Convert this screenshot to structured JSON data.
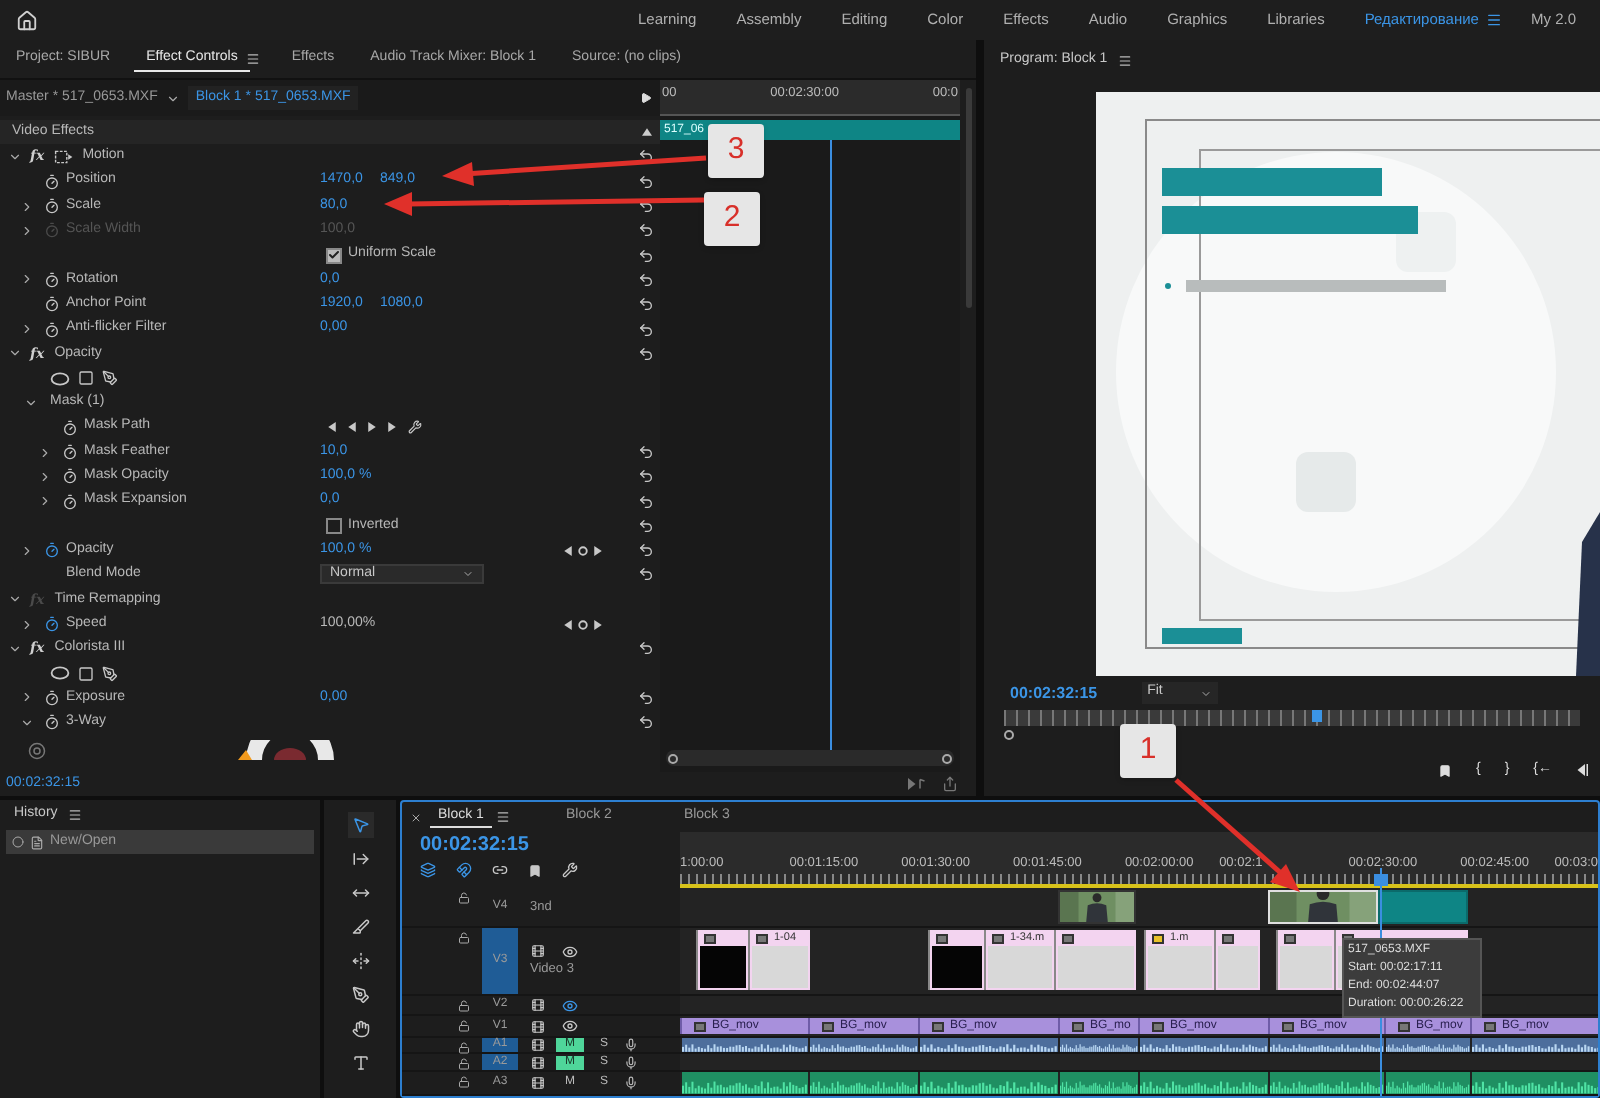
{
  "workspace": {
    "tabs": [
      {
        "label": "Learning",
        "selected": false
      },
      {
        "label": "Assembly",
        "selected": false
      },
      {
        "label": "Editing",
        "selected": false
      },
      {
        "label": "Color",
        "selected": false
      },
      {
        "label": "Effects",
        "selected": false
      },
      {
        "label": "Audio",
        "selected": false
      },
      {
        "label": "Graphics",
        "selected": false
      },
      {
        "label": "Libraries",
        "selected": false
      },
      {
        "label": "Редактирование",
        "selected": true
      },
      {
        "label": "My 2.0",
        "selected": false
      }
    ]
  },
  "panels": {
    "tabs": [
      {
        "label": "Project: SIBUR",
        "selected": false
      },
      {
        "label": "Effect Controls",
        "selected": true
      },
      {
        "label": "Effects",
        "selected": false
      },
      {
        "label": "Audio Track Mixer: Block 1",
        "selected": false
      },
      {
        "label": "Source: (no clips)",
        "selected": false
      }
    ]
  },
  "effect_controls": {
    "master_clip": "Master * 517_0653.MXF",
    "sequence_clip": "Block 1 * 517_0653.MXF",
    "ruler": [
      "00",
      "00:02:30:00",
      "00:0"
    ],
    "clip": "517_06",
    "header": "Video Effects",
    "effects": [
      {
        "kind": "effect",
        "badge": "fx",
        "label": "Motion",
        "fx_enabled": true,
        "motion_icon": true,
        "expanded": true,
        "reset": true,
        "children": [
          {
            "kind": "property",
            "label": "Position",
            "values": [
              "1470,0",
              "849,0"
            ],
            "expandable": false,
            "animated": false,
            "disabled": false,
            "keyframe_nav": false,
            "reset": true
          },
          {
            "kind": "property",
            "label": "Scale",
            "values": [
              "80,0"
            ],
            "expandable": true,
            "expanded": false,
            "animated": false,
            "disabled": false,
            "keyframe_nav": false,
            "reset": true
          },
          {
            "kind": "property",
            "label": "Scale Width",
            "values": [
              "100,0"
            ],
            "expandable": true,
            "expanded": false,
            "animated": false,
            "disabled": true,
            "keyframe_nav": false,
            "reset": true
          },
          {
            "kind": "checkbox",
            "label": "Uniform Scale",
            "checked": true,
            "reset": true
          },
          {
            "kind": "property",
            "label": "Rotation",
            "values": [
              "0,0"
            ],
            "expandable": true,
            "expanded": false,
            "animated": false,
            "disabled": false,
            "keyframe_nav": false,
            "reset": true
          },
          {
            "kind": "property",
            "label": "Anchor Point",
            "values": [
              "1920,0",
              "1080,0"
            ],
            "expandable": false,
            "animated": false,
            "disabled": false,
            "keyframe_nav": false,
            "reset": true
          },
          {
            "kind": "property",
            "label": "Anti-flicker Filter",
            "values": [
              "0,00"
            ],
            "expandable": true,
            "expanded": false,
            "animated": false,
            "disabled": false,
            "keyframe_nav": false,
            "reset": true
          }
        ]
      },
      {
        "kind": "effect",
        "badge": "fx",
        "label": "Opacity",
        "fx_enabled": true,
        "motion_icon": false,
        "expanded": true,
        "reset": true,
        "children": [
          {
            "kind": "mask_tools"
          },
          {
            "kind": "group",
            "label": "Mask (1)",
            "expanded": true,
            "children": [
              {
                "kind": "mask_path",
                "label": "Mask Path"
              },
              {
                "kind": "property",
                "label": "Mask Feather",
                "values": [
                  "10,0"
                ],
                "expandable": true,
                "expanded": false,
                "animated": false,
                "disabled": false,
                "keyframe_nav": false,
                "reset": true
              },
              {
                "kind": "property",
                "label": "Mask Opacity",
                "values": [
                  "100,0 %"
                ],
                "expandable": true,
                "expanded": false,
                "animated": false,
                "disabled": false,
                "keyframe_nav": false,
                "reset": true
              },
              {
                "kind": "property",
                "label": "Mask Expansion",
                "values": [
                  "0,0"
                ],
                "expandable": true,
                "expanded": false,
                "animated": false,
                "disabled": false,
                "keyframe_nav": false,
                "reset": true
              },
              {
                "kind": "checkbox",
                "label": "Inverted",
                "checked": false,
                "reset": true
              }
            ]
          },
          {
            "kind": "property",
            "label": "Opacity",
            "values": [
              "100,0 %"
            ],
            "expandable": true,
            "expanded": false,
            "animated": true,
            "disabled": false,
            "keyframe_nav": true,
            "reset": true
          },
          {
            "kind": "dropdown",
            "label": "Blend Mode",
            "value": "Normal",
            "reset": true
          }
        ]
      },
      {
        "kind": "effect",
        "badge": "fx",
        "label": "Time Remapping",
        "fx_enabled": false,
        "motion_icon": false,
        "expanded": true,
        "reset": false,
        "children": [
          {
            "kind": "property",
            "label": "Speed",
            "values": [
              "100,00%"
            ],
            "expandable": true,
            "expanded": false,
            "animated": true,
            "disabled": false,
            "keyframe_nav": true,
            "reset": false
          }
        ]
      },
      {
        "kind": "effect",
        "badge": "fx",
        "label": "Colorista III",
        "fx_enabled": true,
        "motion_icon": false,
        "expanded": true,
        "reset": true,
        "children": [
          {
            "kind": "mask_tools"
          },
          {
            "kind": "property",
            "label": "Exposure",
            "values": [
              "0,00"
            ],
            "expandable": true,
            "expanded": false,
            "animated": false,
            "disabled": false,
            "keyframe_nav": false,
            "reset": true
          },
          {
            "kind": "property",
            "label": "3-Way",
            "expandable": true,
            "expanded": true,
            "animated": false,
            "disabled": false,
            "keyframe_nav": false,
            "reset": true,
            "children": [
              {
                "kind": "color_wheel"
              }
            ]
          }
        ]
      }
    ],
    "timecode": "00:02:32:15"
  },
  "program": {
    "title": "Program: Block 1",
    "timecode": "00:02:32:15",
    "zoom": "Fit",
    "buttons": [
      {
        "kind": "marker"
      },
      {
        "kind": "glyph",
        "label": "{"
      },
      {
        "kind": "glyph",
        "label": "}"
      },
      {
        "kind": "glyph",
        "label": "{←"
      },
      {
        "kind": "step_back"
      }
    ]
  },
  "history": {
    "title": "History",
    "items": [
      {
        "label": "New/Open",
        "selected": true
      }
    ]
  },
  "tools": [
    {
      "kind": "selection",
      "selected": true
    },
    {
      "kind": "track_select",
      "selected": false
    },
    {
      "kind": "ripple",
      "selected": false
    },
    {
      "kind": "razor",
      "selected": false
    },
    {
      "kind": "slip",
      "selected": false
    },
    {
      "kind": "pen",
      "selected": false
    },
    {
      "kind": "hand",
      "selected": false
    },
    {
      "kind": "type",
      "selected": false
    }
  ],
  "timeline": {
    "tabs": [
      {
        "label": "Block 1",
        "selected": true
      },
      {
        "label": "Block 2",
        "selected": false
      },
      {
        "label": "Block 3",
        "selected": false
      }
    ],
    "timecode": "00:02:32:15",
    "snap": true,
    "ruler": [
      "1:00:00",
      "00:01:15:00",
      "00:01:30:00",
      "00:01:45:00",
      "00:02:00:00",
      "00:02:1",
      "00:02:30:00",
      "00:02:45:00",
      "00:03:0"
    ],
    "tracks": [
      {
        "label": "V4",
        "kind": "video",
        "name": "3nd",
        "targeted": false,
        "controls": false,
        "clips": [
          {
            "kind": "footage",
            "selected": false
          },
          {
            "kind": "footage",
            "selected": true
          },
          {
            "kind": "solid",
            "selected": false
          }
        ]
      },
      {
        "label": "V3",
        "kind": "video",
        "name": "Video 3",
        "targeted": true,
        "controls": true,
        "eye_highlighted": false,
        "clips": [
          {
            "kind": "dark",
            "fx_applied": false
          },
          {
            "kind": "light",
            "label": "1-04",
            "fx_applied": false
          },
          {
            "kind": "dark",
            "fx_applied": false
          },
          {
            "kind": "light",
            "label": "1-34.m",
            "fx_applied": false
          },
          {
            "kind": "light",
            "fx_applied": false
          },
          {
            "kind": "light",
            "label": "1.m",
            "fx_applied": true
          },
          {
            "kind": "light",
            "fx_applied": false
          },
          {
            "kind": "light",
            "fx_applied": false
          },
          {
            "kind": "light",
            "fx_applied": false
          }
        ]
      },
      {
        "label": "V2",
        "kind": "video",
        "targeted": false,
        "controls": true,
        "eye_highlighted": true
      },
      {
        "label": "V1",
        "kind": "video",
        "targeted": false,
        "controls": true,
        "eye_highlighted": false,
        "clips": [
          {
            "kind": "graphic",
            "label": "BG_mov"
          },
          {
            "kind": "graphic",
            "label": "BG_mov"
          },
          {
            "kind": "graphic",
            "label": "BG_mov"
          },
          {
            "kind": "graphic",
            "label": "BG_mo"
          },
          {
            "kind": "graphic",
            "label": "BG_mov"
          },
          {
            "kind": "graphic",
            "label": "BG_mov"
          },
          {
            "kind": "graphic",
            "label": "BG_mov"
          },
          {
            "kind": "graphic",
            "label": "BG_mov"
          }
        ]
      },
      {
        "label": "A1",
        "kind": "audio",
        "targeted": true,
        "muted": true,
        "mute": "M",
        "solo": "S",
        "clips": [
          {
            "kind": "blue"
          },
          {
            "kind": "blue"
          },
          {
            "kind": "blue"
          },
          {
            "kind": "blue"
          },
          {
            "kind": "blue"
          },
          {
            "kind": "blue"
          },
          {
            "kind": "blue"
          },
          {
            "kind": "blue"
          }
        ]
      },
      {
        "label": "A2",
        "kind": "audio",
        "targeted": true,
        "muted": true,
        "mute": "M",
        "solo": "S"
      },
      {
        "label": "A3",
        "kind": "audio",
        "targeted": false,
        "muted": false,
        "mute": "M",
        "solo": "S",
        "clips": [
          {
            "kind": "green"
          },
          {
            "kind": "green"
          },
          {
            "kind": "green"
          },
          {
            "kind": "green"
          },
          {
            "kind": "green"
          },
          {
            "kind": "green"
          },
          {
            "kind": "green"
          },
          {
            "kind": "green"
          }
        ]
      }
    ],
    "tooltip": {
      "title": "517_0653.MXF",
      "lines": [
        "Start: 00:02:17:11",
        "End: 00:02:44:07",
        "Duration: 00:00:26:22"
      ]
    }
  },
  "annotations": [
    {
      "label": "3"
    },
    {
      "label": "2"
    },
    {
      "label": "1"
    }
  ]
}
